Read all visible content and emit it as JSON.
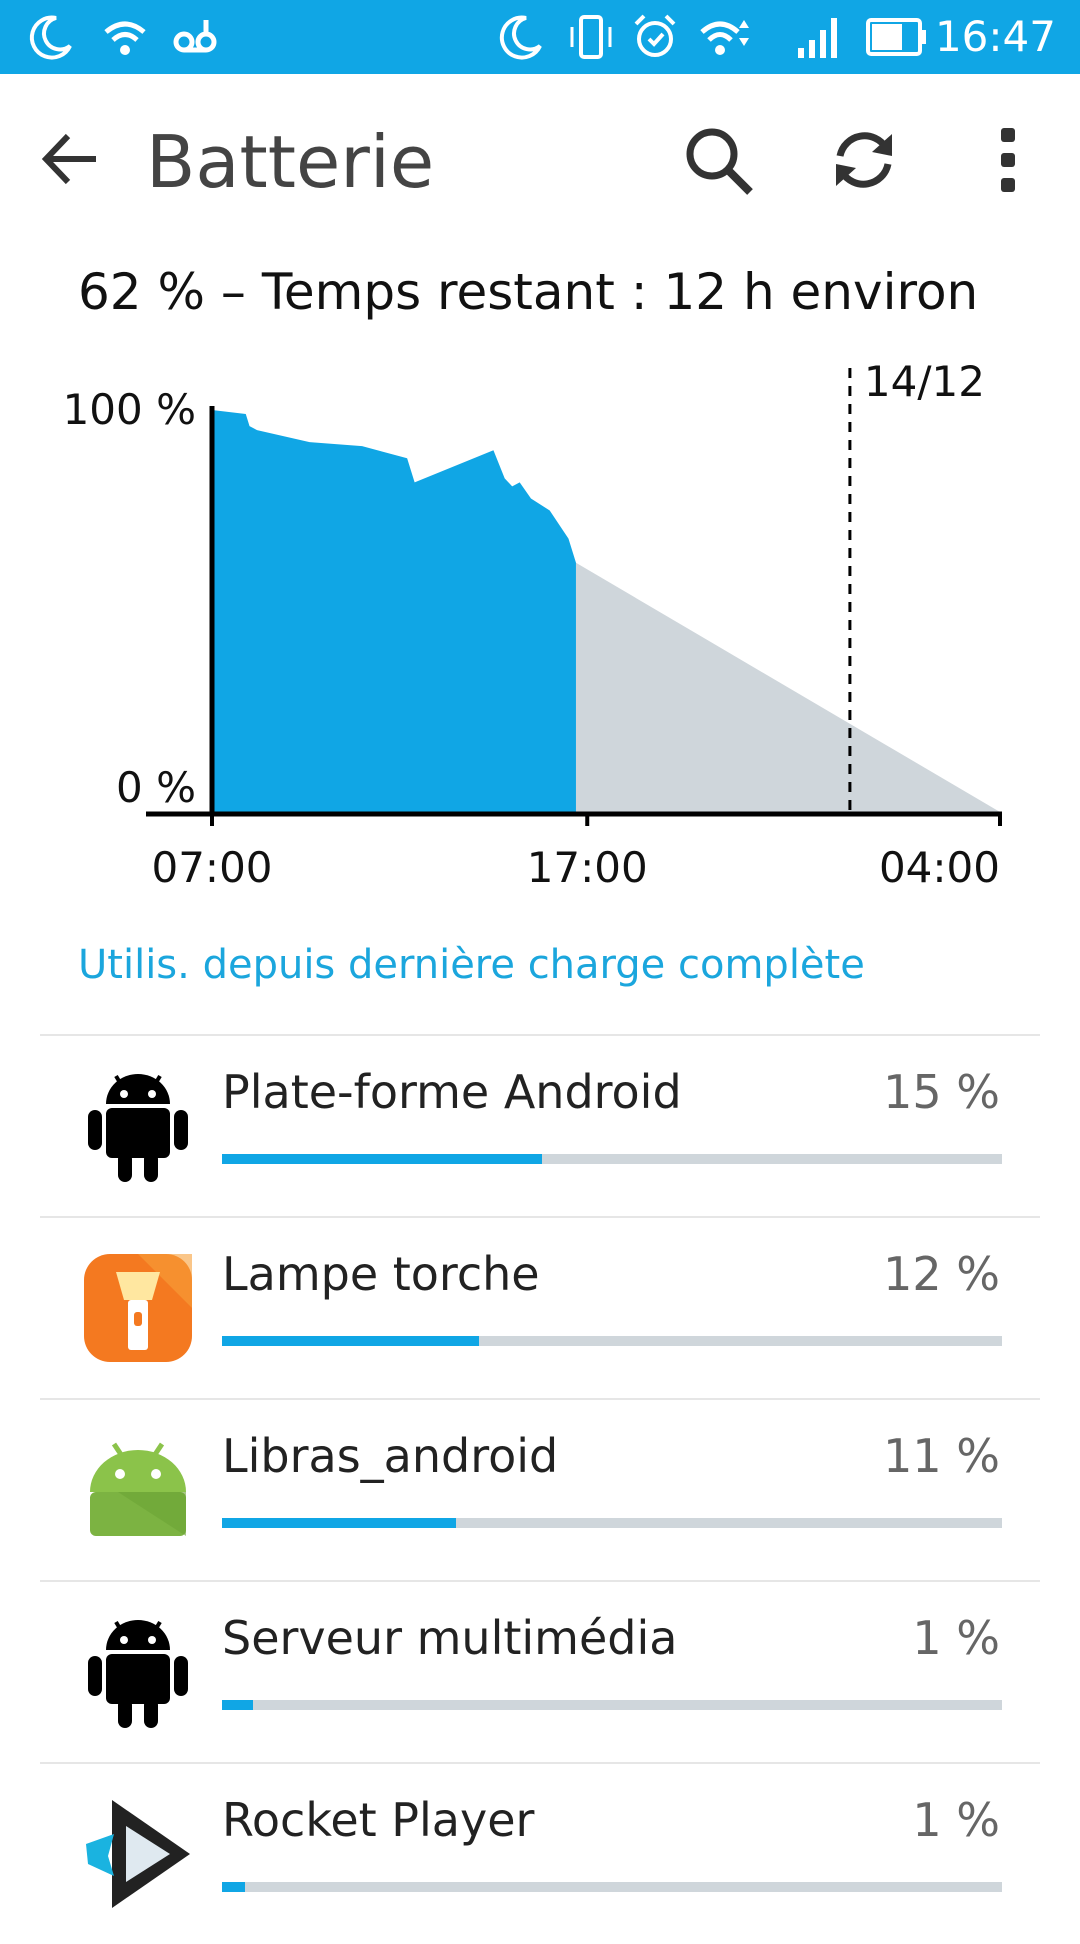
{
  "status_bar": {
    "time": "16:47",
    "icons": [
      "moon-icon",
      "wifi-icon",
      "voicemail-icon",
      "moon-icon",
      "vibrate-icon",
      "alarm-icon",
      "wifi-data-icon",
      "signal-icon",
      "battery-icon"
    ]
  },
  "header": {
    "title": "Batterie",
    "back_icon": "arrow-left-icon",
    "actions": [
      "search-icon",
      "refresh-icon",
      "more-vert-icon"
    ]
  },
  "summary": "62 % – Temps restant : 12 h environ",
  "chart_data": {
    "type": "area",
    "y_tick_labels": [
      "100 %",
      "0 %"
    ],
    "x_tick_labels": [
      "07:00",
      "17:00",
      "04:00"
    ],
    "marker_label": "14/12",
    "ylim": [
      0,
      100
    ],
    "series": [
      {
        "kind": "measured",
        "color": "#10a6e5",
        "x": [
          7.0,
          7.9,
          8.0,
          8.2,
          9.6,
          11.0,
          12.2,
          12.4,
          14.5,
          14.8,
          15.0,
          15.2,
          15.5,
          16.0,
          16.5,
          16.7
        ],
        "y": [
          100,
          99,
          96,
          95,
          92,
          91,
          88,
          82,
          90,
          83,
          81,
          82,
          78,
          75,
          68,
          62
        ]
      },
      {
        "kind": "estimated",
        "color": "#cfd6db",
        "x": [
          16.7,
          28.0
        ],
        "y": [
          62,
          0
        ]
      }
    ],
    "marker_x": 24.0,
    "colors": {
      "measured": "#10a6e5",
      "estimated": "#cfd6db",
      "axis": "#000000"
    }
  },
  "section_link": "Utilis. depuis dernière charge complète",
  "apps": [
    {
      "name": "Plate-forme Android",
      "percent_label": "15 %",
      "usage": 0.41,
      "icon": "android-black-icon"
    },
    {
      "name": "Lampe torche",
      "percent_label": "12 %",
      "usage": 0.33,
      "icon": "flashlight-icon"
    },
    {
      "name": "Libras_android",
      "percent_label": "11 %",
      "usage": 0.3,
      "icon": "android-green-icon"
    },
    {
      "name": "Serveur multimédia",
      "percent_label": "1 %",
      "usage": 0.04,
      "icon": "android-black-icon"
    },
    {
      "name": "Rocket Player",
      "percent_label": "1 %",
      "usage": 0.03,
      "icon": "rocket-player-icon"
    }
  ]
}
